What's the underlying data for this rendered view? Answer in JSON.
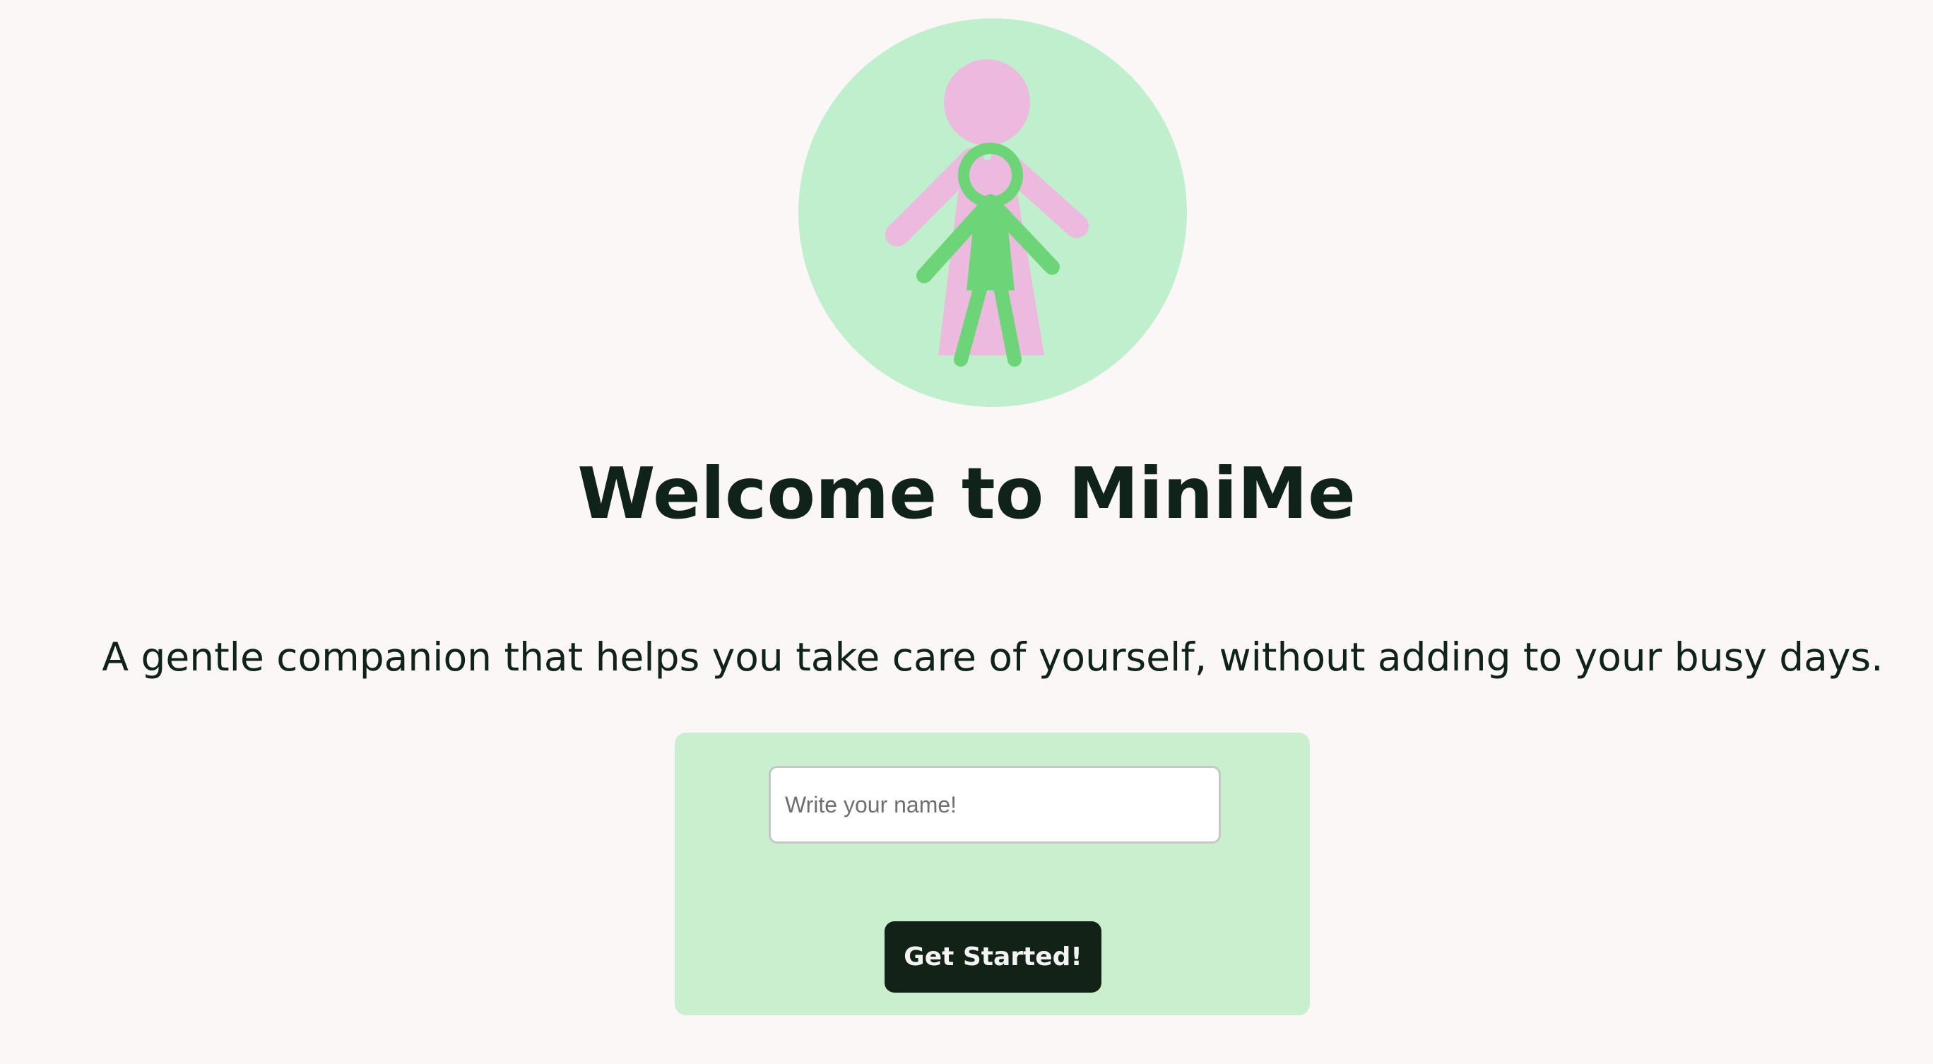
{
  "header": {
    "title": "Welcome to MiniMe",
    "subtitle": "A gentle companion that helps you take care of yourself, without adding to your busy days."
  },
  "logo": {
    "icon": "companion-figures-icon",
    "circle_color": "#bfefcd",
    "adult_color": "#ecbadf",
    "child_color": "#6dd477"
  },
  "form": {
    "name_placeholder": "Write your name!",
    "name_value": "",
    "submit_label": "Get Started!"
  },
  "colors": {
    "background": "#fbf7f7",
    "card": "#c9efcf",
    "button": "#122216",
    "text": "#10231a"
  }
}
